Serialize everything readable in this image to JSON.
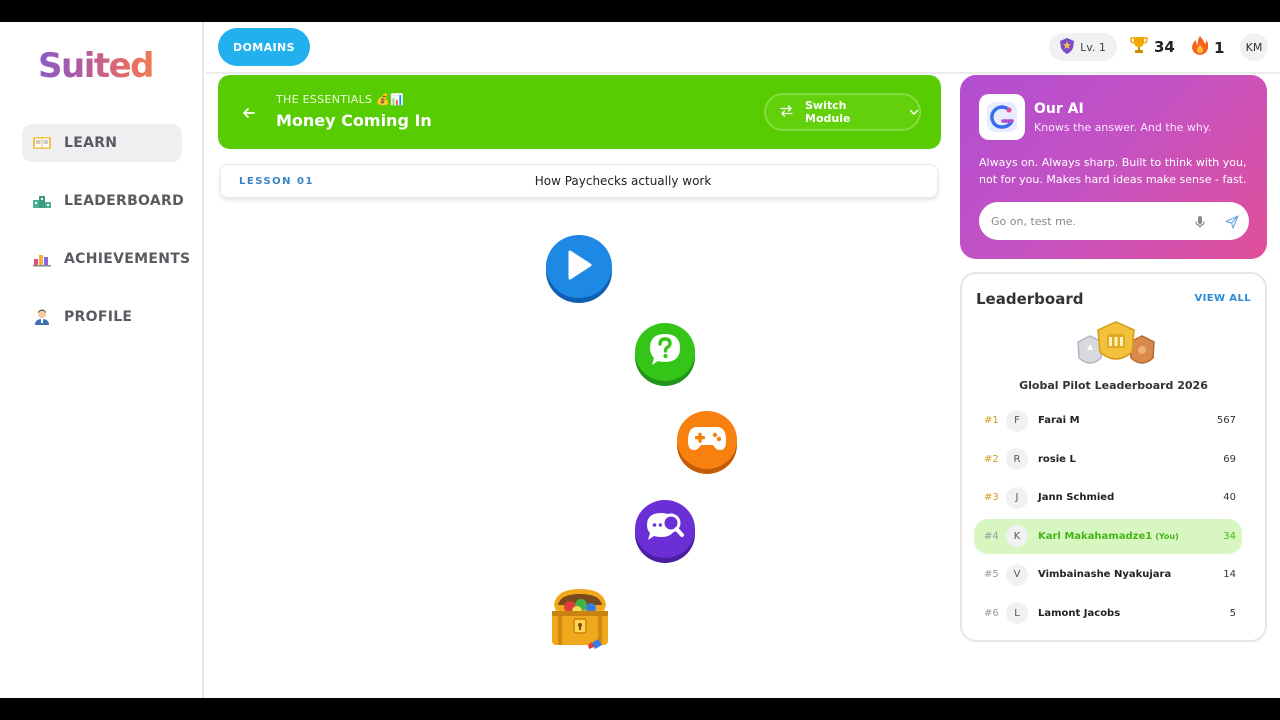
{
  "app": {
    "logo": "Suited"
  },
  "sidebar": {
    "items": [
      {
        "label": "LEARN",
        "icon": "book-icon",
        "active": true
      },
      {
        "label": "LEADERBOARD",
        "icon": "podium-icon",
        "active": false
      },
      {
        "label": "ACHIEVEMENTS",
        "icon": "bar-chart-icon",
        "active": false
      },
      {
        "label": "PROFILE",
        "icon": "user-icon",
        "active": false
      }
    ]
  },
  "topbar": {
    "domains_label": "DOMAINS",
    "level": "Lv. 1",
    "trophies": "34",
    "streak": "1",
    "user_initials": "KM"
  },
  "module": {
    "subtitle": "THE ESSENTIALS 💰📊",
    "title": "Money Coming In",
    "switch_label": "Switch Module"
  },
  "lesson": {
    "number": "LESSON 01",
    "title": "How Paychecks actually work"
  },
  "path_nodes": [
    {
      "type": "play-icon",
      "color": "#1e88e5"
    },
    {
      "type": "question-icon",
      "color": "#35c418"
    },
    {
      "type": "gamepad-icon",
      "color": "#f7800e"
    },
    {
      "type": "chat-search-icon",
      "color": "#6b2fd6"
    },
    {
      "type": "treasure-chest-icon"
    }
  ],
  "ai": {
    "title": "Our AI",
    "subtitle": "Knows the answer. And the why.",
    "description": "Always on. Always sharp. Built to think with you, not for you. Makes hard ideas make sense - fast.",
    "input_placeholder": "Go on, test me."
  },
  "leaderboard": {
    "title": "Leaderboard",
    "view_all": "VIEW ALL",
    "name": "Global Pilot Leaderboard 2026",
    "rows": [
      {
        "rank": "#1",
        "initial": "F",
        "name": "Farai M",
        "you": "",
        "score": "567",
        "rank_color": "#d19a1c"
      },
      {
        "rank": "#2",
        "initial": "R",
        "name": "rosie L",
        "you": "",
        "score": "69",
        "rank_color": "#d19a1c"
      },
      {
        "rank": "#3",
        "initial": "J",
        "name": "Jann Schmied",
        "you": "",
        "score": "40",
        "rank_color": "#d19a1c"
      },
      {
        "rank": "#4",
        "initial": "K",
        "name": "Karl Makahamadze1",
        "you": "(You)",
        "score": "34",
        "rank_color": "#999999"
      },
      {
        "rank": "#5",
        "initial": "V",
        "name": "Vimbainashe Nyakujara",
        "you": "",
        "score": "14",
        "rank_color": "#999999"
      },
      {
        "rank": "#6",
        "initial": "L",
        "name": "Lamont Jacobs",
        "you": "",
        "score": "5",
        "rank_color": "#999999"
      }
    ]
  },
  "colors": {
    "accent_blue": "#22b0ee",
    "module_green": "#58cc02",
    "you_highlight": "#d8f7c0"
  }
}
